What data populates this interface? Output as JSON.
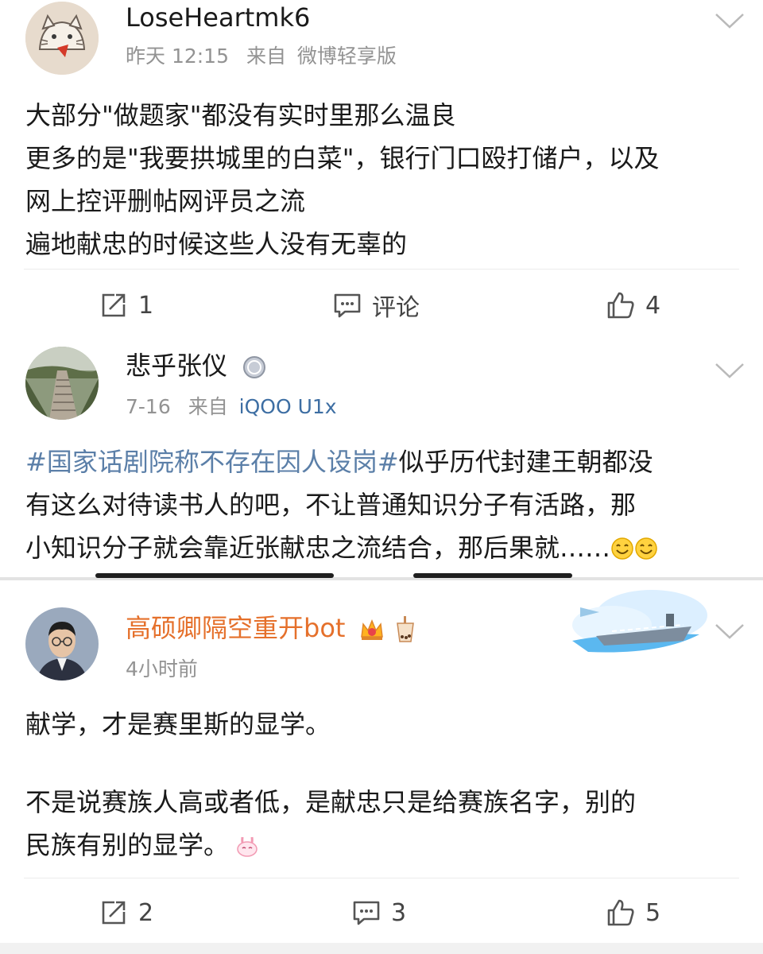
{
  "posts": [
    {
      "username": "LoseHeartmk6",
      "time": "昨天 12:15",
      "from_prefix": "来自",
      "source": "微博轻享版",
      "lines": [
        "大部分\"做题家\"都没有实时里那么温良",
        "更多的是\"我要拱城里的白菜\"，银行门口殴打储户，以及",
        "网上控评删帖网评员之流",
        "遍地献忠的时候这些人没有无辜的"
      ],
      "actions": {
        "repost": "1",
        "comment": "评论",
        "like": "4"
      }
    },
    {
      "username": "悲乎张仪",
      "time": "7-16",
      "from_prefix": "来自",
      "source": "iQOO U1x",
      "topic": "#国家话剧院称不存在因人设岗#",
      "lines": [
        "似乎历代封建王朝都没",
        "有这么对待读书人的吧，不让普通知识分子有活路，那",
        "小知识分子就会靠近张献忠之流结合，那后果就……"
      ]
    },
    {
      "username": "高硕卿隔空重开bot",
      "time": "4小时前",
      "lines": [
        "献学，才是赛里斯的显学。",
        "",
        "不是说赛族人高或者低，是献忠只是给赛族名字，别的",
        "民族有别的显学。"
      ],
      "actions": {
        "repost": "2",
        "comment": "3",
        "like": "5"
      }
    }
  ],
  "colors": {
    "username_highlight": "#e5702b",
    "topic_link": "#5b7fa8",
    "source_link": "#3d6ea3",
    "meta_gray": "#939393"
  },
  "icons": [
    "chevron-down-icon",
    "repost-icon",
    "comment-icon",
    "like-icon",
    "medal-icon",
    "crown-icon",
    "bubble-tea-icon",
    "smile-emoji",
    "bunny-emoji",
    "carrier-banner"
  ]
}
